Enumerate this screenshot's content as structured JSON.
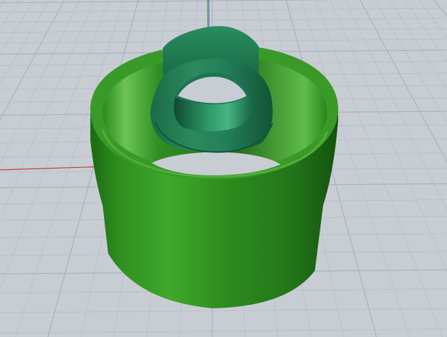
{
  "viewport": {
    "kind": "3D perspective viewport",
    "background_color": "#c8cdd4",
    "grid": {
      "visible": true,
      "minor_line_color": "#b7bdc6",
      "major_line_color": "#a9b0ba"
    },
    "axes": {
      "x_axis_color": "#c0392b",
      "y_axis_color": "#2a9d3a",
      "z_axis_color": "#2f4fa8"
    }
  },
  "model": {
    "outer_ring": {
      "shape": "cylinder-shell",
      "color": "#2e8a1e",
      "highlight_color": "#4fb13a",
      "shadow_color": "#14520e"
    },
    "inner_part": {
      "shape": "ring-with-tab",
      "color": "#217a52",
      "highlight_color": "#3aa577",
      "shadow_color": "#0f4a31"
    }
  }
}
